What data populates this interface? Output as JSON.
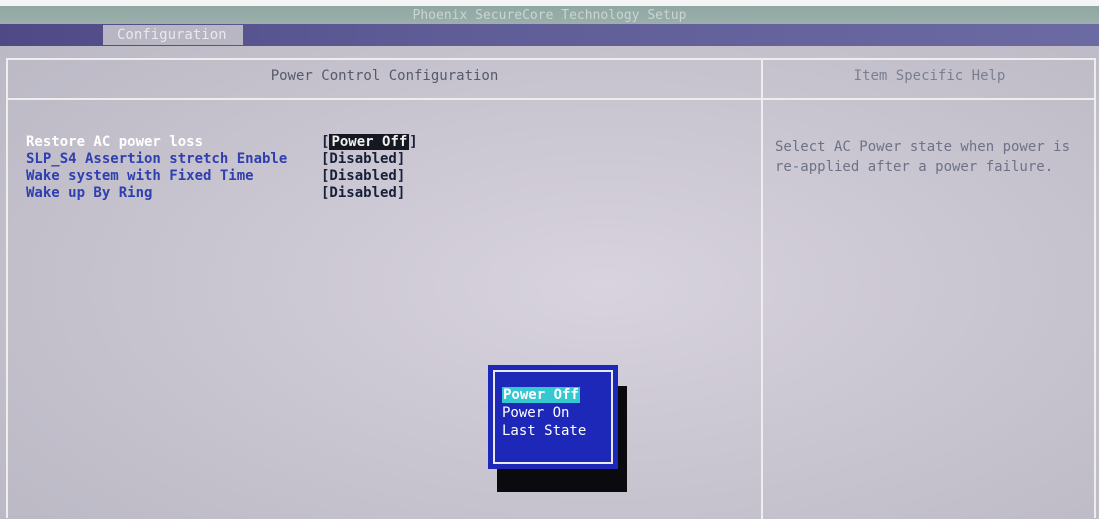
{
  "window": {
    "title": "Phoenix SecureCore Technology Setup"
  },
  "menu": {
    "active_tab": "Configuration"
  },
  "main": {
    "title": "Power Control Configuration",
    "items": [
      {
        "label": "Restore AC power loss",
        "value": "Power Off",
        "selected": true
      },
      {
        "label": "SLP_S4 Assertion stretch Enable",
        "value": "[Disabled]"
      },
      {
        "label": "Wake system with Fixed Time",
        "value": "[Disabled]"
      },
      {
        "label": "Wake up By Ring",
        "value": "[Disabled]"
      }
    ]
  },
  "help": {
    "title": "Item Specific Help",
    "line1": "Select AC Power state when power is",
    "line2": "re-applied after a power failure."
  },
  "popup": {
    "options": [
      "Power Off",
      "Power On",
      "Last State"
    ],
    "selected_index": 0
  },
  "colors": {
    "menubar": "#5f5c96",
    "popup_bg": "#1d28b8",
    "popup_highlight": "#35c8d0",
    "value_highlight": "#151821"
  }
}
